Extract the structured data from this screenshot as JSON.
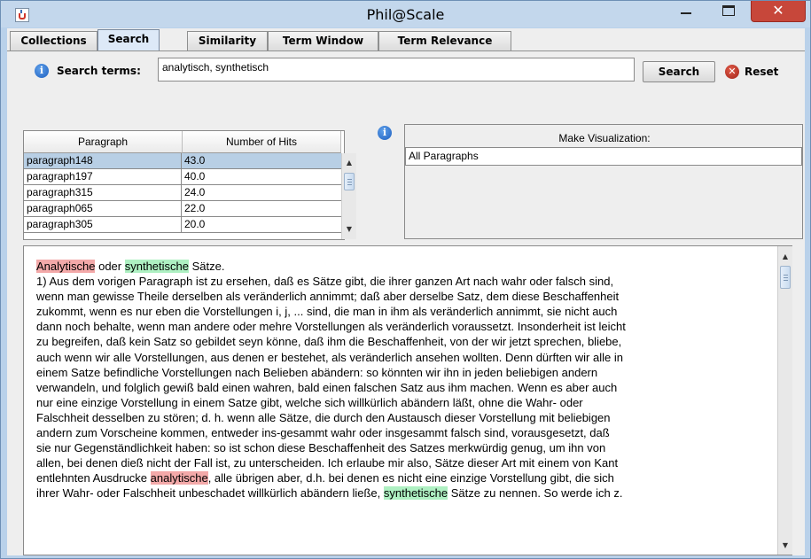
{
  "window": {
    "title": "Phil@Scale",
    "close_glyph": "✕"
  },
  "tabs": [
    {
      "label": "Collections"
    },
    {
      "label": "Search",
      "active": true
    },
    {
      "label": "Similarity"
    },
    {
      "label": "Term Window"
    },
    {
      "label": "Term Relevance"
    }
  ],
  "search": {
    "label": "Search terms:",
    "value": "analytisch, synthetisch",
    "search_button": "Search",
    "reset_button": "Reset"
  },
  "results_table": {
    "columns": [
      "Paragraph",
      "Number of Hits"
    ],
    "rows": [
      {
        "paragraph": "paragraph148",
        "hits": "43.0"
      },
      {
        "paragraph": "paragraph197",
        "hits": "40.0"
      },
      {
        "paragraph": "paragraph315",
        "hits": "24.0"
      },
      {
        "paragraph": "paragraph065",
        "hits": "22.0"
      },
      {
        "paragraph": "paragraph305",
        "hits": "20.0"
      }
    ]
  },
  "visualization": {
    "title": "Make Visualization:",
    "selected": "All Paragraphs"
  },
  "text": {
    "title_analytic": "Analytische",
    "title_oder": " oder ",
    "title_synthetic": "synthetische",
    "title_rest": " Sätze.",
    "lines": [
      "1) Aus dem vorigen Paragraph ist zu ersehen, daß es Sätze gibt, die ihrer ganzen Art nach wahr oder falsch sind,",
      "wenn man gewisse Theile derselben als veränderlich annimmt; daß aber derselbe Satz, dem diese Beschaffenheit",
      "zukommt, wenn es nur eben die Vorstellungen i, j, ... sind, die man in ihm als veränderlich annimmt, sie nicht auch",
      "dann noch behalte, wenn man andere oder mehre Vorstellungen als veränderlich voraussetzt. Insonderheit ist leicht",
      "zu begreifen, daß kein Satz so gebildet seyn könne, daß ihm die Beschaffenheit, von der wir jetzt sprechen, bliebe,",
      "auch wenn wir alle Vorstellungen, aus denen er bestehet, als veränderlich ansehen wollten. Denn dürften wir alle in",
      "einem Satze befindliche Vorstellungen nach Belieben abändern: so könnten wir ihn in jeden beliebigen andern",
      "verwandeln, und folglich gewiß bald einen wahren, bald einen falschen Satz aus ihm machen. Wenn es aber auch",
      "nur eine einzige Vorstellung in einem Satze gibt, welche sich willkürlich abändern läßt, ohne die Wahr- oder",
      "Falschheit desselben zu stören; d. h. wenn alle Sätze, die durch den Austausch dieser Vorstellung mit beliebigen",
      "andern zum Vorscheine kommen, entweder ins-gesammt wahr oder insgesammt falsch sind, vorausgesetzt, daß",
      "sie nur Gegenständlichkeit haben: so ist schon diese Beschaffenheit des Satzes merkwürdig genug, um ihn von",
      "allen, bei denen dieß nicht der Fall ist, zu unterscheiden. Ich erlaube mir also, Sätze dieser Art mit einem von Kant"
    ],
    "line14_pre": "entlehnten Ausdrucke ",
    "line14_hl": "analytische",
    "line14_post": ", alle übrigen aber, d.h. bei denen es nicht eine einzige Vorstellung gibt, die sich",
    "line15_pre": "ihrer Wahr- oder Falschheit unbeschadet willkürlich abändern ließe, ",
    "line15_hl": "synthetische",
    "line15_post": " Sätze zu nennen. So werde ich z."
  },
  "colors": {
    "analytic_highlight": "#f3a9a9",
    "synthetic_highlight": "#aef0c2",
    "selected_row": "#b8cfe5"
  }
}
